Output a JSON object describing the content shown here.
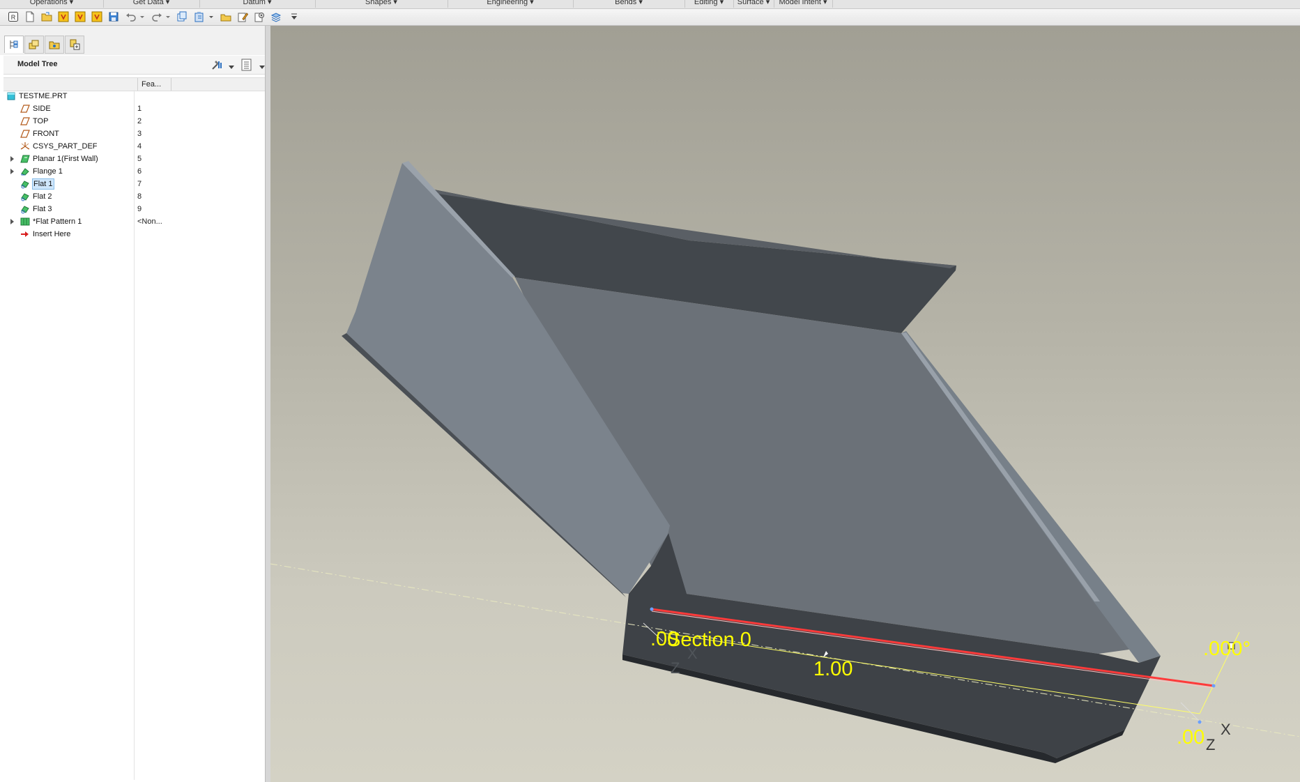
{
  "ribbon": {
    "groups": [
      "Operations",
      "Get Data",
      "Datum",
      "Shapes",
      "Engineering",
      "Bends",
      "Editing",
      "Surface",
      "Model Intent"
    ]
  },
  "quick_access": {
    "icons": [
      "app-icon",
      "new-file-icon",
      "open-file-icon",
      "regenerate-icon",
      "regenerate-all-icon",
      "regenerate-other-icon",
      "save-icon",
      "undo-icon",
      "undo-dropdown-icon",
      "redo-icon",
      "redo-dropdown-icon",
      "copy-icon",
      "paste-icon",
      "paste-dropdown-icon",
      "open-folder-icon",
      "edit-icon",
      "settings-icon",
      "layers-icon",
      "customize-dropdown-icon"
    ]
  },
  "panel": {
    "tabs": [
      "model-tree-tab-icon",
      "layers-tab-icon",
      "folder-browser-tab-icon",
      "favorites-tab-icon"
    ],
    "tree_title": "Model Tree",
    "column_header": "Fea...",
    "rows": [
      {
        "label": "TESTME.PRT",
        "num": "",
        "icon": "part-icon",
        "expander": false,
        "selected": false
      },
      {
        "label": "SIDE",
        "num": "1",
        "icon": "datum-plane-icon",
        "expander": false,
        "selected": false
      },
      {
        "label": "TOP",
        "num": "2",
        "icon": "datum-plane-icon",
        "expander": false,
        "selected": false
      },
      {
        "label": "FRONT",
        "num": "3",
        "icon": "datum-plane-icon",
        "expander": false,
        "selected": false
      },
      {
        "label": "CSYS_PART_DEF",
        "num": "4",
        "icon": "csys-icon",
        "expander": false,
        "selected": false
      },
      {
        "label": "Planar 1(First Wall)",
        "num": "5",
        "icon": "planar-wall-icon",
        "expander": true,
        "selected": false
      },
      {
        "label": "Flange 1",
        "num": "6",
        "icon": "flange-icon",
        "expander": true,
        "selected": false
      },
      {
        "label": "Flat 1",
        "num": "7",
        "icon": "flat-wall-icon",
        "expander": false,
        "selected": true
      },
      {
        "label": "Flat 2",
        "num": "8",
        "icon": "flat-wall-icon",
        "expander": false,
        "selected": false
      },
      {
        "label": "Flat 3",
        "num": "9",
        "icon": "flat-wall-icon",
        "expander": false,
        "selected": false
      },
      {
        "label": "*Flat Pattern 1",
        "num": "<Non...",
        "icon": "flat-pattern-icon",
        "expander": true,
        "selected": false
      },
      {
        "label": "Insert Here",
        "num": "",
        "icon": "insert-here-arrow-icon",
        "expander": false,
        "selected": false
      }
    ]
  },
  "viewport": {
    "section_label": "Section 0",
    "dim_length": "1.00",
    "dim_left": ".00",
    "dim_right": ".00",
    "dim_angle": ".000°",
    "axis_x_left": "X",
    "axis_z_left": "Z",
    "axis_x_right": "X",
    "axis_z_right": "Z",
    "colors": {
      "dim_text": "#ffff00",
      "highlight_edge": "#ff3a3a",
      "background_top": "#a19f94",
      "background_bottom": "#d4d2c5"
    }
  }
}
